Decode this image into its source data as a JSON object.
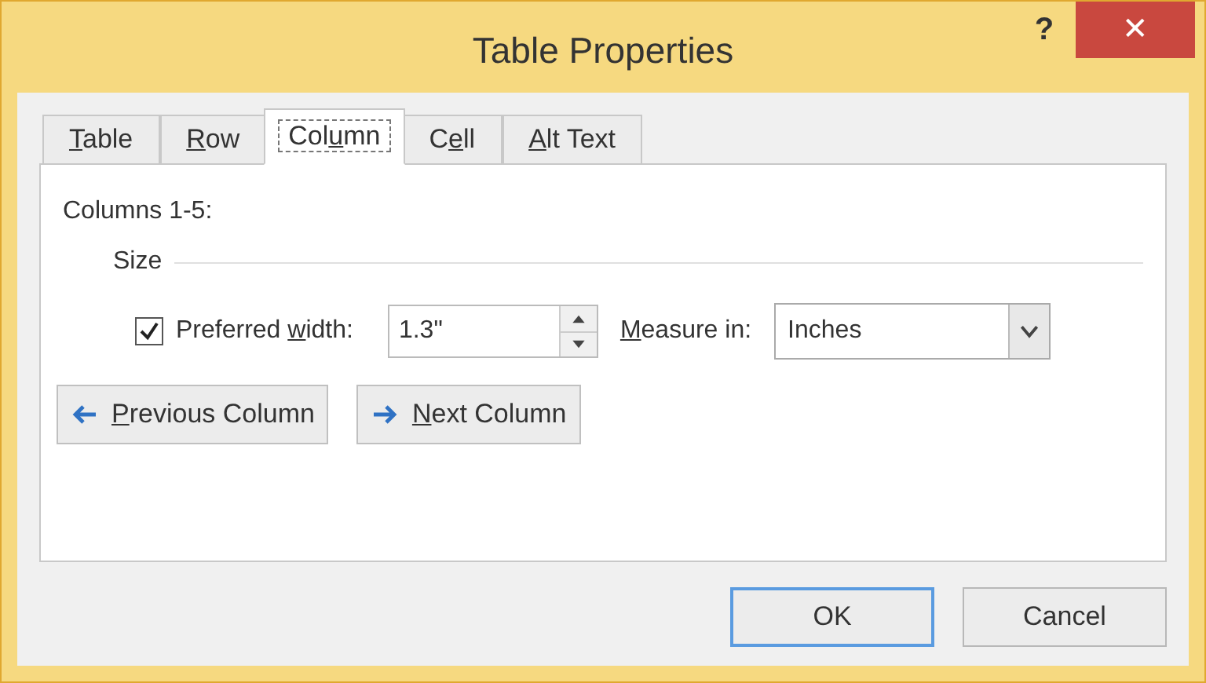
{
  "window": {
    "title": "Table Properties",
    "help": "?",
    "close": "✕"
  },
  "tabs": [
    {
      "label": [
        {
          "text": "T",
          "underlined": true
        },
        {
          "text": "able",
          "underlined": false
        }
      ],
      "selected": false
    },
    {
      "label": [
        {
          "text": "R",
          "underlined": true
        },
        {
          "text": "ow",
          "underlined": false
        }
      ],
      "selected": false
    },
    {
      "label": [
        {
          "text": "Col",
          "underlined": false
        },
        {
          "text": "u",
          "underlined": true
        },
        {
          "text": "mn",
          "underlined": false
        }
      ],
      "selected": true
    },
    {
      "label": [
        {
          "text": "C",
          "underlined": false
        },
        {
          "text": "e",
          "underlined": true
        },
        {
          "text": "ll",
          "underlined": false
        }
      ],
      "selected": false
    },
    {
      "label": [
        {
          "text": "A",
          "underlined": true
        },
        {
          "text": "lt Text",
          "underlined": false
        }
      ],
      "selected": false
    }
  ],
  "heading": "Columns 1-5:",
  "group": "Size",
  "preferred_width": {
    "label": [
      {
        "text": "Preferred ",
        "underlined": false
      },
      {
        "text": "w",
        "underlined": true
      },
      {
        "text": "idth:",
        "underlined": false
      }
    ],
    "checked": true,
    "value": "1.3\""
  },
  "measure_in": {
    "label": [
      {
        "text": "M",
        "underlined": true
      },
      {
        "text": "easure in:",
        "underlined": false
      }
    ],
    "value": "Inches"
  },
  "nav_buttons": [
    {
      "kind": "previous",
      "label": [
        {
          "text": "P",
          "underlined": true
        },
        {
          "text": "revious Column",
          "underlined": false
        }
      ]
    },
    {
      "kind": "next",
      "label": [
        {
          "text": "N",
          "underlined": true
        },
        {
          "text": "ext Column",
          "underlined": false
        }
      ]
    }
  ],
  "buttons": [
    {
      "label": "OK",
      "default": true
    },
    {
      "label": "Cancel",
      "default": false
    }
  ]
}
